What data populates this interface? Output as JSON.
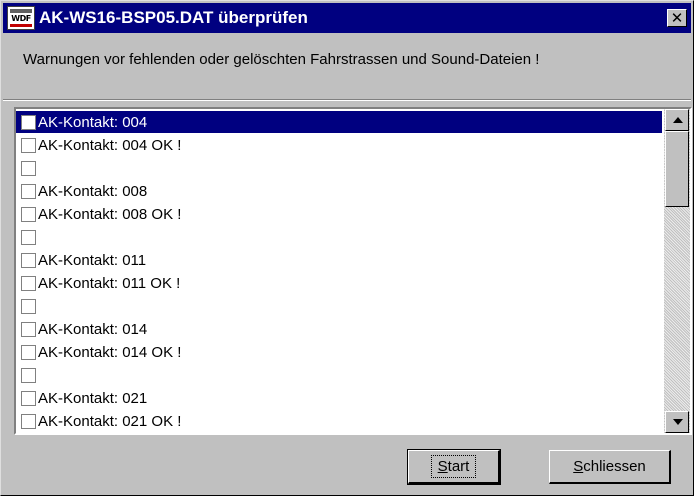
{
  "window": {
    "title": "AK-WS16-BSP05.DAT überprüfen",
    "icon": "app-logo-icon",
    "icon_text": "WDF"
  },
  "message": "Warnungen vor fehlenden oder gelöschten Fahrstrassen und Sound-Dateien !",
  "list": {
    "selected_index": 0,
    "items": [
      {
        "label": "AK-Kontakt: 004",
        "checked": false
      },
      {
        "label": "AK-Kontakt: 004 OK !",
        "checked": false
      },
      {
        "label": "",
        "checked": false
      },
      {
        "label": "AK-Kontakt: 008",
        "checked": false
      },
      {
        "label": "AK-Kontakt: 008 OK !",
        "checked": false
      },
      {
        "label": "",
        "checked": false
      },
      {
        "label": "AK-Kontakt: 011",
        "checked": false
      },
      {
        "label": "AK-Kontakt: 011 OK !",
        "checked": false
      },
      {
        "label": "",
        "checked": false
      },
      {
        "label": "AK-Kontakt: 014",
        "checked": false
      },
      {
        "label": "AK-Kontakt: 014 OK !",
        "checked": false
      },
      {
        "label": "",
        "checked": false
      },
      {
        "label": "AK-Kontakt: 021",
        "checked": false
      },
      {
        "label": "AK-Kontakt: 021 OK !",
        "checked": false
      }
    ]
  },
  "buttons": {
    "start_first": "S",
    "start_rest": "tart",
    "close_first": "S",
    "close_rest": "chliessen"
  },
  "icons": {
    "close": "close-icon",
    "scroll_up": "arrow-up-icon",
    "scroll_down": "arrow-down-icon"
  },
  "colors": {
    "titlebar": "#000080",
    "selection": "#000080",
    "face": "#c0c0c0"
  }
}
